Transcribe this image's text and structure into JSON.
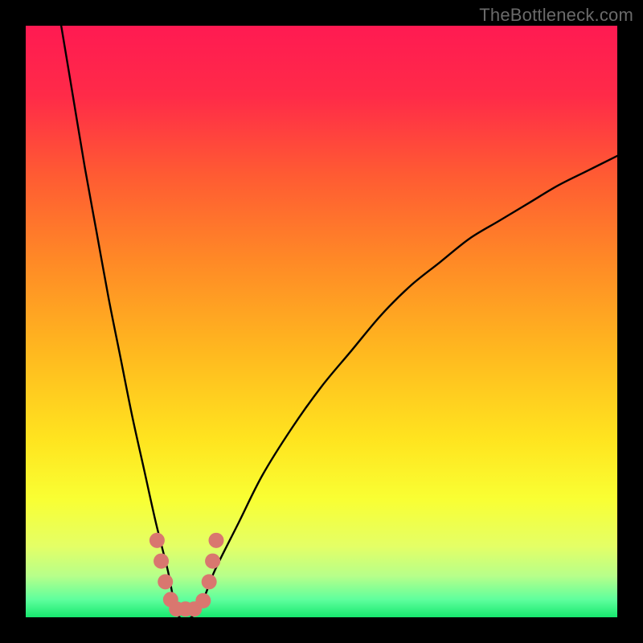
{
  "watermark": "TheBottleneck.com",
  "chart_data": {
    "type": "line",
    "title": "",
    "xlabel": "",
    "ylabel": "",
    "xlim": [
      0,
      100
    ],
    "ylim": [
      0,
      100
    ],
    "gradient_stops": [
      {
        "offset": 0.0,
        "color": "#ff1a52"
      },
      {
        "offset": 0.12,
        "color": "#ff2b48"
      },
      {
        "offset": 0.25,
        "color": "#ff5a33"
      },
      {
        "offset": 0.4,
        "color": "#ff8a26"
      },
      {
        "offset": 0.55,
        "color": "#ffb81f"
      },
      {
        "offset": 0.7,
        "color": "#ffe41f"
      },
      {
        "offset": 0.8,
        "color": "#f9ff33"
      },
      {
        "offset": 0.88,
        "color": "#e4ff66"
      },
      {
        "offset": 0.93,
        "color": "#b7ff8a"
      },
      {
        "offset": 0.97,
        "color": "#5fff9d"
      },
      {
        "offset": 1.0,
        "color": "#17e86f"
      }
    ],
    "series": [
      {
        "name": "bottleneck-curve",
        "x": [
          6,
          8,
          10,
          12,
          14,
          16,
          18,
          20,
          22,
          24,
          25,
          26,
          28,
          30,
          32,
          36,
          40,
          45,
          50,
          55,
          60,
          65,
          70,
          75,
          80,
          85,
          90,
          95,
          100
        ],
        "y": [
          100,
          88,
          76,
          65,
          54,
          44,
          34,
          25,
          16,
          8,
          3,
          0,
          0,
          3,
          8,
          16,
          24,
          32,
          39,
          45,
          51,
          56,
          60,
          64,
          67,
          70,
          73,
          75.5,
          78
        ]
      }
    ],
    "markers": {
      "name": "highlight-dots",
      "color": "#d9776f",
      "points": [
        {
          "x": 22.2,
          "y": 13.0
        },
        {
          "x": 22.9,
          "y": 9.5
        },
        {
          "x": 23.6,
          "y": 6.0
        },
        {
          "x": 24.5,
          "y": 3.0
        },
        {
          "x": 25.5,
          "y": 1.4
        },
        {
          "x": 27.0,
          "y": 1.4
        },
        {
          "x": 28.5,
          "y": 1.4
        },
        {
          "x": 30.0,
          "y": 2.8
        },
        {
          "x": 31.0,
          "y": 6.0
        },
        {
          "x": 31.6,
          "y": 9.5
        },
        {
          "x": 32.2,
          "y": 13.0
        }
      ]
    }
  }
}
